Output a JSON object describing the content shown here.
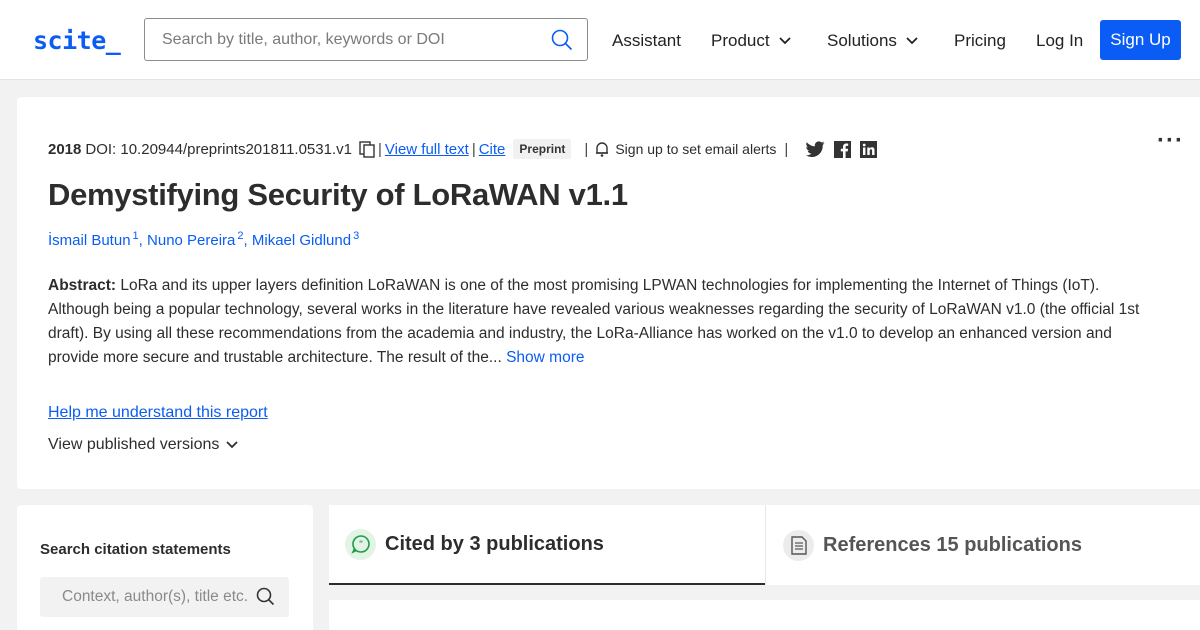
{
  "header": {
    "logo": "scite_",
    "search_placeholder": "Search by title, author, keywords or DOI",
    "nav": [
      "Assistant",
      "Product",
      "Solutions",
      "Pricing",
      "Log In"
    ],
    "signup_label": "Sign Up",
    "accent_color": "#0a5cf5"
  },
  "paper": {
    "year": "2018",
    "doi": "DOI: 10.20944/preprints201811.0531.v1",
    "view_full_text": "View full text",
    "cite": "Cite",
    "badge": "Preprint",
    "alerts": "Sign up to set email alerts",
    "title": "Demystifying Security of LoRaWAN v1.1",
    "authors": [
      {
        "name": "İsmail Butun",
        "sup": "1"
      },
      {
        "name": "Nuno Pereira",
        "sup": "2"
      },
      {
        "name": "Mikael Gidlund",
        "sup": "3"
      }
    ],
    "abstract_label": "Abstract:",
    "abstract_lines": [
      "LoRa and its upper layers definition LoRaWAN is one of the most promising LPWAN technologies for implementing the Internet of Things (IoT).",
      "Although being a popular technology, several works in the literature have revealed various weaknesses regarding the security of LoRaWAN v1.0 (the official 1st",
      "draft). By using all these recommendations from the academia and industry, the LoRa-Alliance has worked on the v1.0 to develop an enhanced version and",
      "provide more secure and trustable architecture. The result of the..."
    ],
    "show_more": "Show more",
    "help_link": "Help me understand this report",
    "published_versions": "View published versions"
  },
  "sidebar": {
    "title": "Search citation statements",
    "search_placeholder": "Context, author(s), title etc."
  },
  "tabs": {
    "cited_by": "Cited by 3 publications",
    "references": "References 15 publications"
  }
}
